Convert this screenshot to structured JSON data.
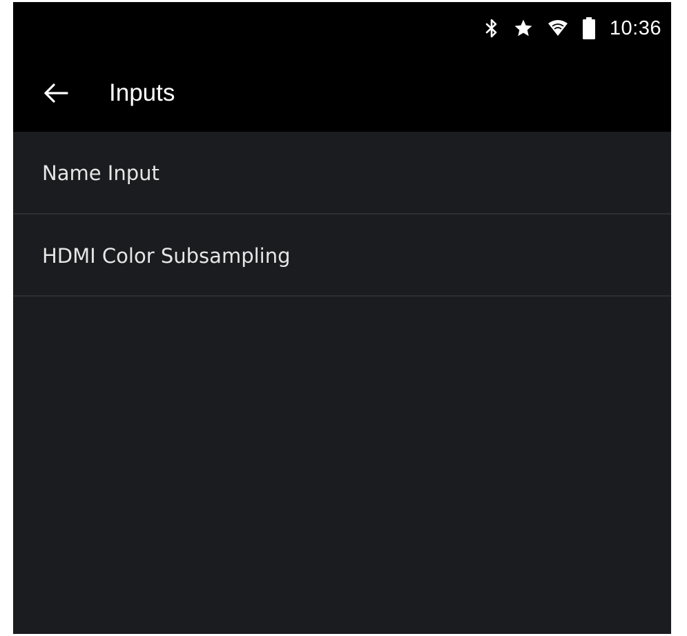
{
  "status_bar": {
    "time": "10:36",
    "icons": [
      "bluetooth-icon",
      "star-icon",
      "wifi-icon",
      "battery-icon"
    ]
  },
  "app_bar": {
    "back_icon": "arrow-left-icon",
    "title": "Inputs"
  },
  "menu": {
    "items": [
      {
        "label": "Name Input"
      },
      {
        "label": "HDMI Color Subsampling"
      }
    ]
  },
  "colors": {
    "status_bar_bg": "#000000",
    "app_bar_bg": "#000000",
    "content_bg": "#1a1c1f",
    "divider": "#2c2f33",
    "text_primary": "#ffffff",
    "text_item": "#e6e6e6"
  }
}
